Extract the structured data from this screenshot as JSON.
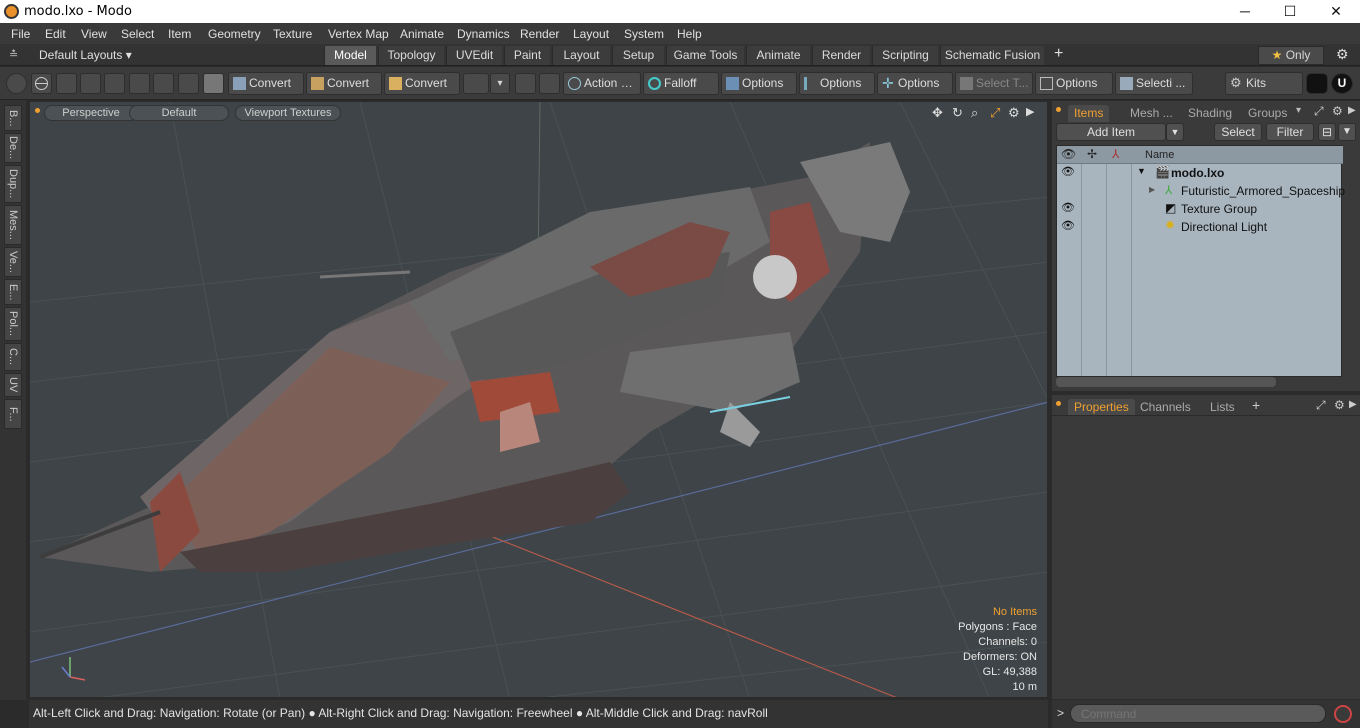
{
  "window": {
    "title": "modo.lxo - Modo",
    "min": "─",
    "max": "☐",
    "close": "✕"
  },
  "menu": [
    "File",
    "Edit",
    "View",
    "Select",
    "Item",
    "Geometry",
    "Texture",
    "Vertex Map",
    "Animate",
    "Dynamics",
    "Render",
    "Layout",
    "System",
    "Help"
  ],
  "layouts": {
    "dropdown": "Default Layouts",
    "tabs": [
      "Model",
      "Topology",
      "UVEdit",
      "Paint",
      "Layout",
      "Setup",
      "Game Tools",
      "Animate",
      "Render",
      "Scripting",
      "Schematic Fusion"
    ],
    "active": "Model",
    "add": "+",
    "only": "Only"
  },
  "toolbar": {
    "convert1": "Convert",
    "convert2": "Convert",
    "convert3": "Convert",
    "action": "Action",
    "falloff": "Falloff",
    "options1": "Options",
    "options2": "Options",
    "options3": "Options",
    "select_t": "Select T...",
    "options4": "Options",
    "selecti": "Selecti ...",
    "kits": "Kits"
  },
  "left_strip": [
    "B...",
    "De...",
    "Dup...",
    "Mes...",
    "Ve...",
    "E...",
    "Pol...",
    "C...",
    "UV",
    "F..."
  ],
  "viewport": {
    "perspective": "Perspective",
    "default": "Default",
    "textures": "Viewport Textures",
    "hud": {
      "no_items": "No Items",
      "polygons": "Polygons : Face",
      "channels": "Channels: 0",
      "deformers": "Deformers: ON",
      "gl": "GL: 49,388",
      "scale": "10 m"
    }
  },
  "items_panel": {
    "tabs": [
      "Items",
      "Mesh ...",
      "Shading",
      "Groups"
    ],
    "add_item": "Add Item",
    "select": "Select",
    "filter": "Filter",
    "name_header": "Name",
    "rows": [
      {
        "label": "modo.lxo"
      },
      {
        "label": "Futuristic_Armored_Spaceship"
      },
      {
        "label": "Texture Group"
      },
      {
        "label": "Directional Light"
      }
    ]
  },
  "props_panel": {
    "tabs": [
      "Properties",
      "Channels",
      "Lists"
    ],
    "add": "+"
  },
  "status": "Alt-Left Click and Drag: Navigation: Rotate (or Pan) ● Alt-Right Click and Drag: Navigation: Freewheel ● Alt-Middle Click and Drag: navRoll",
  "command": {
    "prompt": ">",
    "placeholder": "Command"
  },
  "colors": {
    "accent": "#f0a030",
    "viewport_bg": "#3e4447",
    "tree_bg": "#a8b5bf"
  }
}
